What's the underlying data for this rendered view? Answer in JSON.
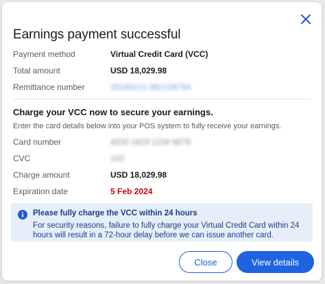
{
  "dialog": {
    "title": "Earnings payment successful",
    "close_icon": "close-icon"
  },
  "summary": {
    "rows": [
      {
        "label": "Payment method",
        "value": "Virtual Credit Card (VCC)"
      },
      {
        "label": "Total amount",
        "value": "USD 18,029.98"
      },
      {
        "label": "Remittance number",
        "value": "20240101-982108784"
      }
    ]
  },
  "vcc": {
    "title": "Charge your VCC now to secure your earnings.",
    "subtitle": "Enter the card details below into your POS system to fully receive your earnings.",
    "rows": [
      {
        "label": "Card number",
        "value": "4200 1819 1234 6678"
      },
      {
        "label": "CVC",
        "value": "103"
      },
      {
        "label": "Charge amount",
        "value": "USD 18,029.98"
      },
      {
        "label": "Expiration date",
        "value": "5 Feb 2024"
      }
    ]
  },
  "notice": {
    "icon": "info-icon",
    "title": "Please fully charge the VCC within 24 hours",
    "body": "For security reasons, failure to fully charge your Virtual Credit Card within 24 hours will result in a 72-hour delay before we can issue another card."
  },
  "actions": {
    "close_label": "Close",
    "view_label": "View details"
  },
  "colors": {
    "primary": "#1e63e0",
    "danger": "#d1000d",
    "notice_bg": "#e6eef9",
    "notice_text": "#1d3c82"
  }
}
